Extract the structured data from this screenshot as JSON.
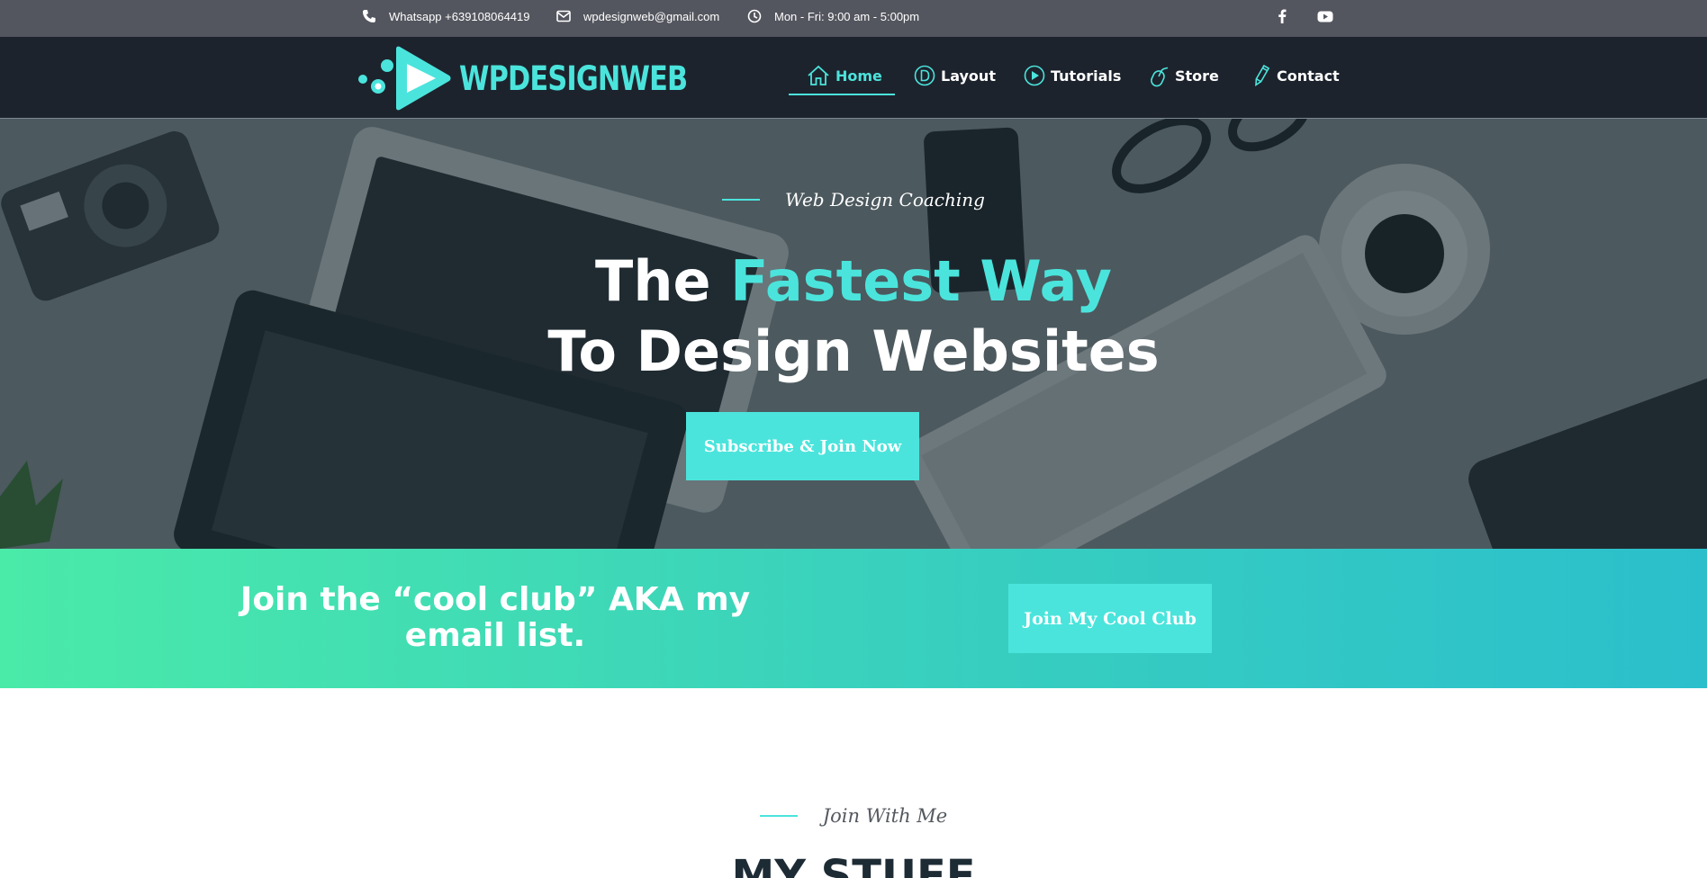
{
  "topbar": {
    "whatsapp": "Whatsapp +639108064419",
    "email": "wpdesignweb@gmail.com",
    "hours": "Mon - Fri: 9:00 am - 5:00pm",
    "social": [
      "facebook-icon",
      "youtube-icon"
    ]
  },
  "nav": {
    "logo": "WPDESIGNWEB",
    "items": [
      {
        "label": "Home",
        "icon": "home-icon",
        "active": true
      },
      {
        "label": "Layout",
        "icon": "layout-d-icon",
        "active": false
      },
      {
        "label": "Tutorials",
        "icon": "play-circle-icon",
        "active": false
      },
      {
        "label": "Store",
        "icon": "mouse-icon",
        "active": false
      },
      {
        "label": "Contact",
        "icon": "pencil-icon",
        "active": false
      }
    ]
  },
  "hero": {
    "eyebrow": "Web Design Coaching",
    "title_part1": "The ",
    "title_accent": "Fastest Way",
    "title_line2": "To Design Websites",
    "button": "Subscribe & Join Now"
  },
  "club": {
    "text": "Join the “cool club” AKA my email list.",
    "button": "Join My Cool Club"
  },
  "stuff": {
    "eyebrow": "Join With Me",
    "title": "MY STUFF"
  },
  "colors": {
    "accent": "#4be4dc",
    "topbar": "#54565f",
    "navbar": "#1d232d",
    "gradient_start": "#4aeaa9",
    "gradient_end": "#2bbfcc"
  }
}
